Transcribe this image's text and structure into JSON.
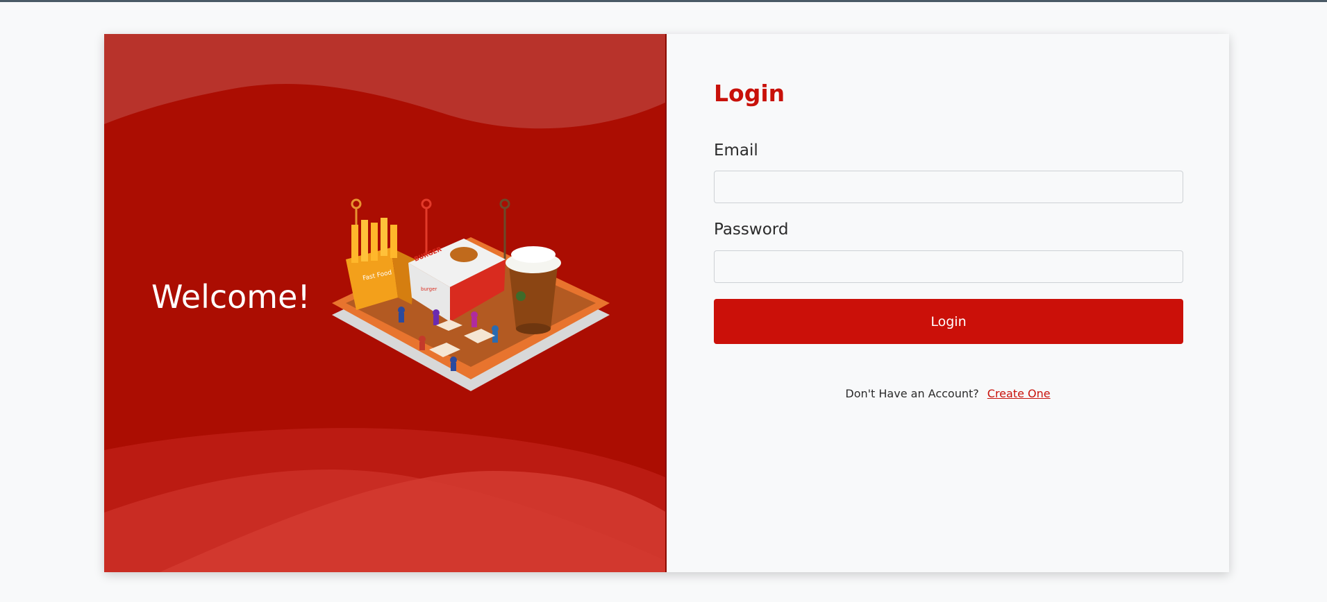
{
  "colors": {
    "brand_red": "#c8110a",
    "panel_red": "#ab0d02",
    "page_background": "#f8f9fa"
  },
  "hero": {
    "welcome_text": "Welcome!",
    "illustration_icon": "fast-food-tray-illustration",
    "illustration_signs": {
      "fries": "Fast Food",
      "box": "BURGER",
      "box_small": "burger"
    }
  },
  "login_form": {
    "title": "Login",
    "email": {
      "label": "Email",
      "value": "",
      "placeholder": ""
    },
    "password": {
      "label": "Password",
      "value": "",
      "placeholder": ""
    },
    "submit_label": "Login",
    "signup_prompt": "Don't Have an Account?",
    "signup_link": "Create One"
  }
}
